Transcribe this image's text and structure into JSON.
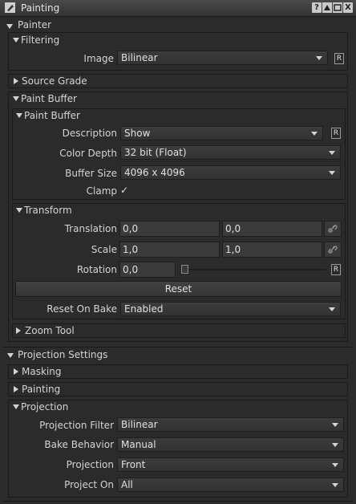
{
  "window": {
    "title": "Painting",
    "help_label": "?",
    "close_label": "X"
  },
  "painter": {
    "title": "Painter"
  },
  "filtering": {
    "title": "Filtering",
    "image_label": "Image",
    "image_value": "Bilinear",
    "reset_label": "R"
  },
  "source_grade": {
    "title": "Source Grade"
  },
  "paint_buffer_section": {
    "title": "Paint Buffer"
  },
  "paint_buffer": {
    "title": "Paint Buffer",
    "description_label": "Description",
    "description_value": "Show",
    "reset_label": "R",
    "color_depth_label": "Color Depth",
    "color_depth_value": "32 bit (Float)",
    "buffer_size_label": "Buffer Size",
    "buffer_size_value": "4096 x 4096",
    "clamp_label": "Clamp",
    "clamp_checked": true,
    "clamp_check": "✓"
  },
  "transform": {
    "title": "Transform",
    "translation_label": "Translation",
    "translation_x": "0,0",
    "translation_y": "0,0",
    "scale_label": "Scale",
    "scale_x": "1,0",
    "scale_y": "1,0",
    "rotation_label": "Rotation",
    "rotation_value": "0,0",
    "rotation_slider": 0.0,
    "reset_r_label": "R",
    "reset_button": "Reset",
    "reset_on_bake_label": "Reset On Bake",
    "reset_on_bake_value": "Enabled"
  },
  "zoom_tool": {
    "title": "Zoom Tool"
  },
  "projection_settings": {
    "title": "Projection Settings"
  },
  "masking": {
    "title": "Masking"
  },
  "painting": {
    "title": "Painting"
  },
  "projection": {
    "title": "Projection",
    "filter_label": "Projection Filter",
    "filter_value": "Bilinear",
    "bake_label": "Bake Behavior",
    "bake_value": "Manual",
    "projection_label": "Projection",
    "projection_value": "Front",
    "project_on_label": "Project On",
    "project_on_value": "All"
  },
  "icons": [
    "app-icon",
    "help-icon",
    "minimize-icon",
    "restore-icon",
    "close-icon",
    "link-icon",
    "chevron-down-icon"
  ]
}
